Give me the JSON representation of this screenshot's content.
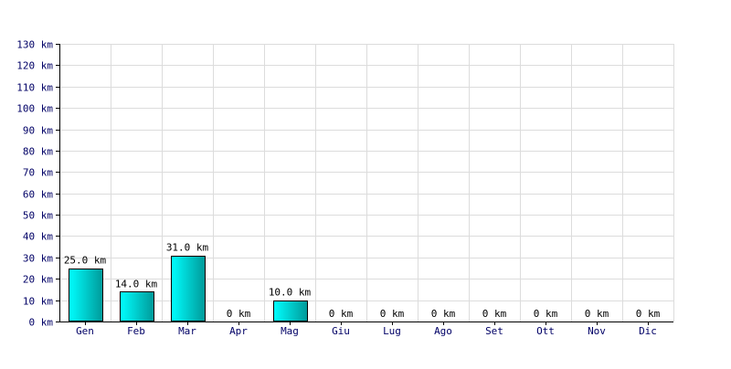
{
  "chart_data": {
    "type": "bar",
    "categories": [
      "Gen",
      "Feb",
      "Mar",
      "Apr",
      "Mag",
      "Giu",
      "Lug",
      "Ago",
      "Set",
      "Ott",
      "Nov",
      "Dic"
    ],
    "values": [
      25.0,
      14.0,
      31.0,
      0,
      10.0,
      0,
      0,
      0,
      0,
      0,
      0,
      0
    ],
    "data_labels": [
      "25.0 km",
      "14.0 km",
      "31.0 km",
      "0 km",
      "10.0 km",
      "0 km",
      "0 km",
      "0 km",
      "0 km",
      "0 km",
      "0 km",
      "0 km"
    ],
    "y_ticks": [
      0,
      10,
      20,
      30,
      40,
      50,
      60,
      70,
      80,
      90,
      100,
      110,
      120,
      130
    ],
    "y_tick_labels": [
      "0 km",
      "10 km",
      "20 km",
      "30 km",
      "40 km",
      "50 km",
      "60 km",
      "70 km",
      "80 km",
      "90 km",
      "100 km",
      "110 km",
      "120 km",
      "130 km"
    ],
    "ylim": [
      0,
      130
    ],
    "unit": "km",
    "grid": true,
    "colors": {
      "bar_light": "#00ffff",
      "bar_dark": "#009999",
      "bar_outline": "#000000",
      "grid": "#dcdcdc",
      "tick_text": "#000066"
    }
  }
}
